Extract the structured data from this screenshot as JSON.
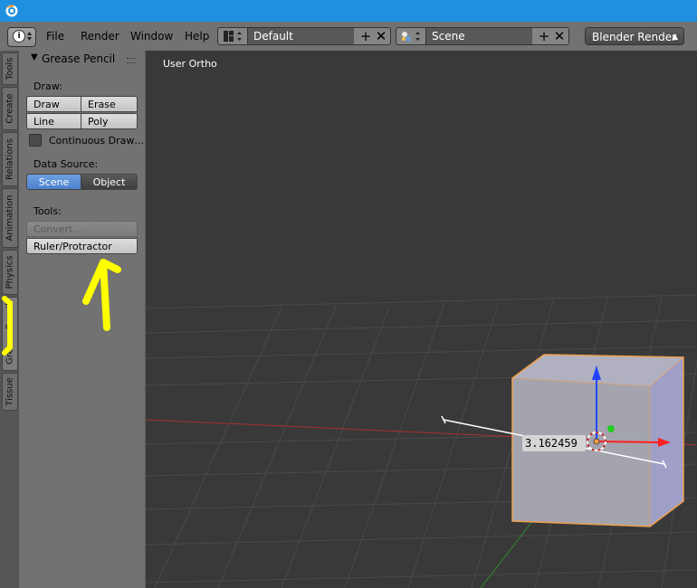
{
  "menubar": {
    "items": [
      "File",
      "Render",
      "Window",
      "Help"
    ],
    "layout": "Default",
    "scene": "Scene",
    "engine": "Blender Render"
  },
  "tabs": [
    "Tools",
    "Create",
    "Relations",
    "Animation",
    "Physics",
    "Grease Pencil",
    "Tissue"
  ],
  "panel": {
    "title": "Grease Pencil",
    "draw_label": "Draw:",
    "draw_buttons": [
      "Draw",
      "Erase",
      "Line",
      "Poly"
    ],
    "continuous_label": "Continuous Draw…",
    "continuous_checked": false,
    "datasource_label": "Data Source:",
    "datasource_options": [
      "Scene",
      "Object"
    ],
    "datasource_selected": "Scene",
    "tools_label": "Tools:",
    "convert_label": "Convert...",
    "ruler_label": "Ruler/Protractor"
  },
  "viewport": {
    "view_name": "User Ortho",
    "ruler_value": "3.162459"
  },
  "colors": {
    "title_bar": "#1f8fe0",
    "selected_button": "#5680c2",
    "annotation_yellow": "#ffff00",
    "x_axis": "#cc2222",
    "y_axis": "#22aa22",
    "z_axis": "#2244ff",
    "selection_outline": "#f2a050"
  }
}
